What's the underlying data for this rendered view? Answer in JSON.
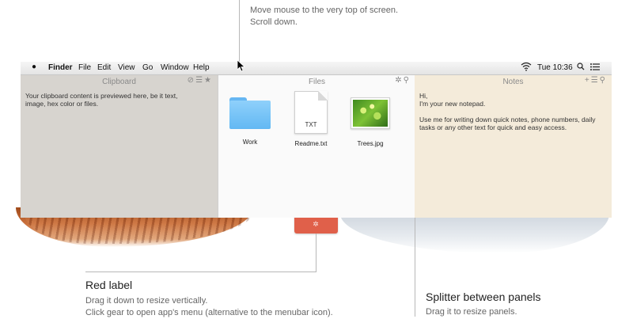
{
  "annotations": {
    "top": {
      "line1": "Move mouse to the very top of screen.",
      "line2": "Scroll down."
    },
    "red_label": {
      "title": "Red label",
      "line1": "Drag it down to resize vertically.",
      "line2": "Click gear to open app's menu (alternative to the menubar icon)."
    },
    "splitter": {
      "title": "Splitter between panels",
      "line1": "Drag it to resize panels."
    }
  },
  "menubar": {
    "apple_icon": "apple-icon",
    "items": [
      "Finder",
      "File",
      "Edit",
      "View",
      "Go",
      "Window",
      "Help"
    ],
    "clock": "Tue 10:36"
  },
  "panels": {
    "clipboard": {
      "title": "Clipboard",
      "body": "Your clipboard content is previewed here, be it text, image, hex color or files."
    },
    "files": {
      "title": "Files",
      "items": [
        {
          "name": "Work",
          "icon": "folder-icon"
        },
        {
          "name": "Readme.txt",
          "icon": "text-file-icon",
          "ext": "TXT"
        },
        {
          "name": "Trees.jpg",
          "icon": "image-file-icon"
        }
      ]
    },
    "notes": {
      "title": "Notes",
      "line1": "Hi,",
      "line2": "I'm your new notepad.",
      "line3": "Use me for writing down quick notes, phone numbers, daily tasks or any other text for quick and easy access."
    }
  },
  "colors": {
    "clipboard_bg": "#d7d4cf",
    "files_bg": "#fafafa",
    "notes_bg": "#f4ebda",
    "red_label": "#e0604a"
  }
}
